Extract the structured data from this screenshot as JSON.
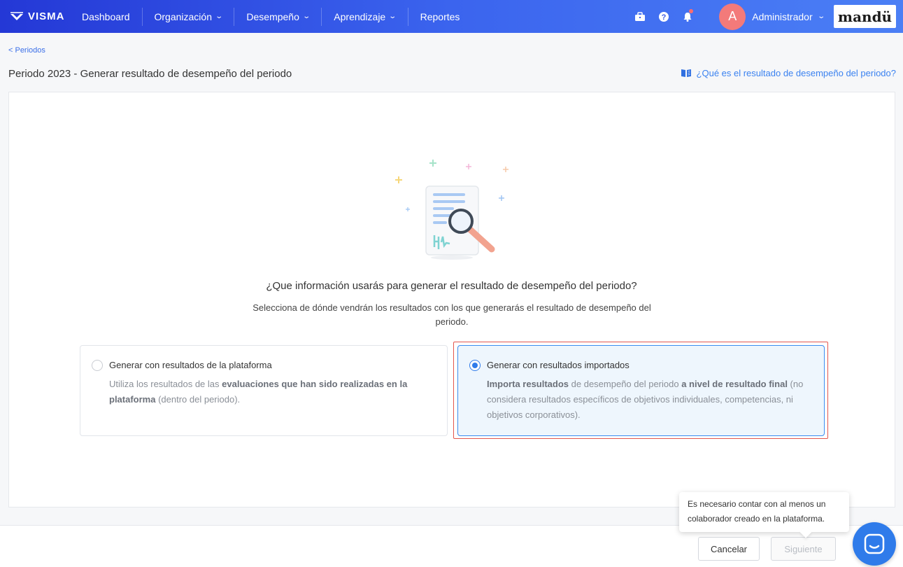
{
  "nav": {
    "brand": "VISMA",
    "items": [
      {
        "label": "Dashboard",
        "dropdown": false
      },
      {
        "label": "Organización",
        "dropdown": true
      },
      {
        "label": "Desempeño",
        "dropdown": true
      },
      {
        "label": "Aprendizaje",
        "dropdown": true
      },
      {
        "label": "Reportes",
        "dropdown": false
      }
    ],
    "icons": [
      "briefcase-icon",
      "help-icon",
      "bell-icon"
    ],
    "notification_count": "1",
    "user": {
      "initial": "A",
      "name": "Administrador"
    },
    "partner_logo": "mandü"
  },
  "breadcrumb": "< Periodos",
  "page_title": "Periodo 2023 - Generar resultado de desempeño del periodo",
  "help_link": "¿Qué es el resultado de desempeño del periodo?",
  "question": {
    "title": "¿Que información usarás para generar el resultado de desempeño del periodo?",
    "subtitle": "Selecciona de dónde vendrán los resultados con los que generarás el resultado de desempeño del periodo."
  },
  "options": [
    {
      "title": "Generar con resultados de la plataforma",
      "desc_1": "Utiliza los resultados de las ",
      "desc_bold_1": "evaluaciones que han sido realizadas en la plataforma",
      "desc_2": " (dentro del periodo).",
      "selected": false
    },
    {
      "title": "Generar con resultados importados",
      "desc_bold_1": "Importa resultados",
      "desc_1": " de desempeño del periodo ",
      "desc_bold_2": "a nivel de resultado final",
      "desc_2": " (no considera resultados específicos de objetivos individuales, competencias, ni objetivos corporativos).",
      "selected": true
    }
  ],
  "tooltip": "Es necesario contar con al menos un colaborador creado en la plataforma.",
  "buttons": {
    "cancel": "Cancelar",
    "next": "Siguiente"
  },
  "colors": {
    "nav_start": "#2438d6",
    "nav_end": "#4b7ff5",
    "accent": "#2f7bea",
    "highlight_outline": "#e2564e",
    "avatar": "#f37a7a"
  }
}
